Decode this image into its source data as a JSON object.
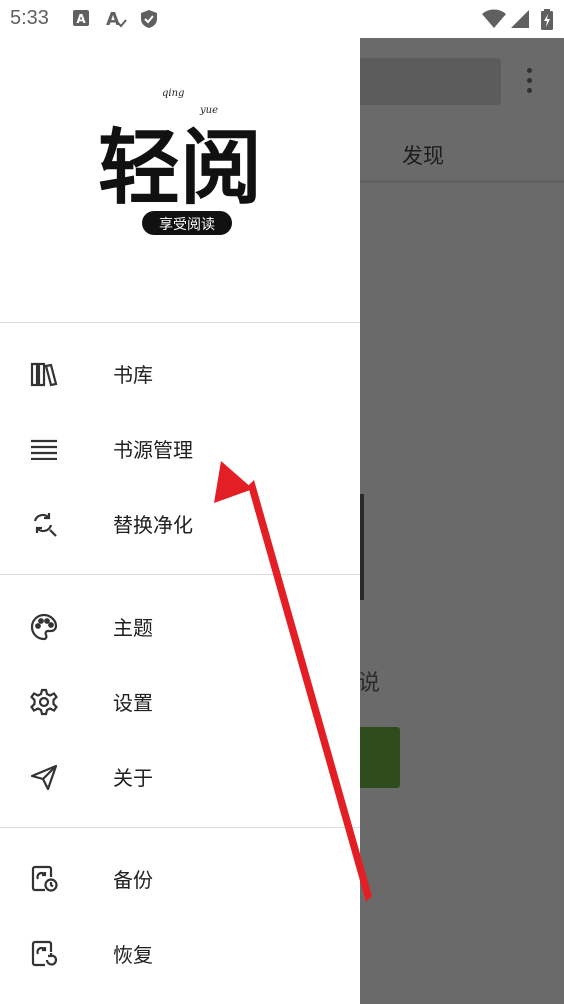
{
  "status_bar": {
    "time": "5:33",
    "left_icons": [
      "a-box-icon",
      "a-autofill-icon",
      "shield-check-icon"
    ],
    "right_icons": [
      "wifi-icon",
      "signal-icon",
      "battery-charging-icon"
    ]
  },
  "background_app": {
    "tab_label": "发现",
    "partial_text": "说",
    "accent_color": "#2f4d1c"
  },
  "drawer": {
    "logo": {
      "main_text": "轻阅",
      "pinyin_top": "qing",
      "pinyin_bottom": "yue",
      "seal_text": "享受阅读"
    },
    "groups": [
      {
        "items": [
          {
            "label": "书库",
            "icon": "library-books-icon"
          },
          {
            "label": "书源管理",
            "icon": "menu-lines-icon"
          },
          {
            "label": "替换净化",
            "icon": "find-replace-icon"
          }
        ]
      },
      {
        "items": [
          {
            "label": "主题",
            "icon": "palette-icon"
          },
          {
            "label": "设置",
            "icon": "gear-icon"
          },
          {
            "label": "关于",
            "icon": "send-icon"
          }
        ]
      },
      {
        "items": [
          {
            "label": "备份",
            "icon": "backup-icon"
          },
          {
            "label": "恢复",
            "icon": "restore-icon"
          }
        ]
      }
    ]
  },
  "annotation": {
    "arrow_color": "#e41e25",
    "points_to": "书源管理"
  }
}
